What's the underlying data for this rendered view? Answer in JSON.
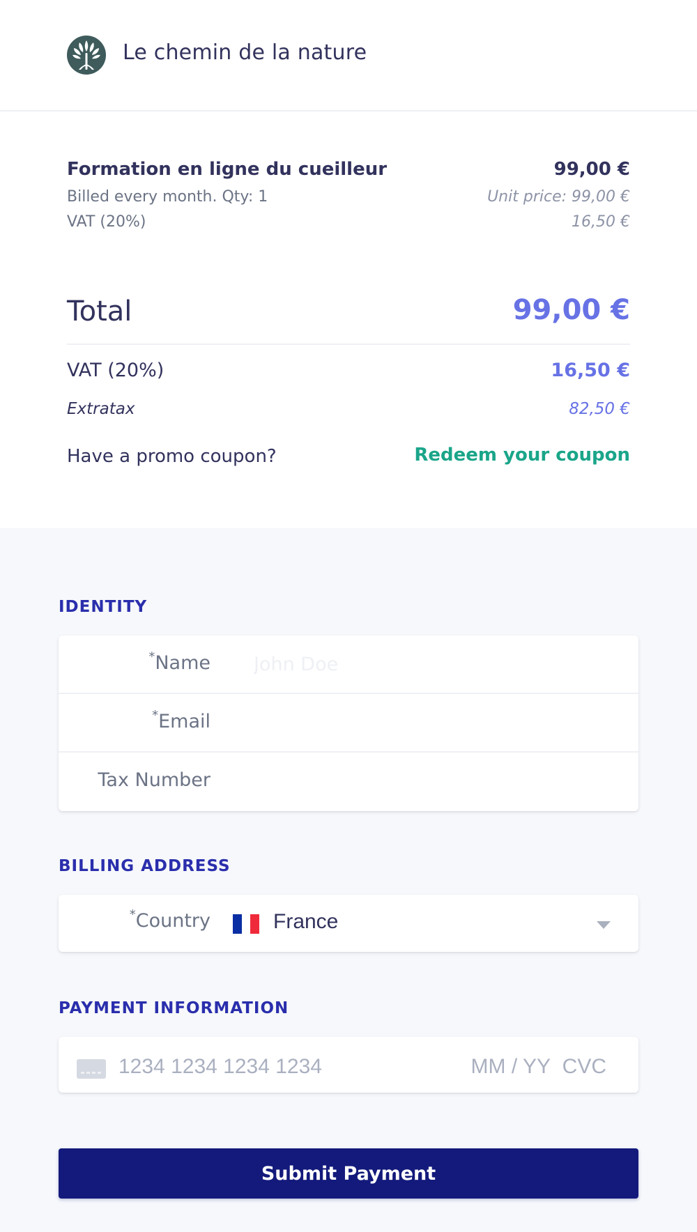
{
  "brand": {
    "name": "Le chemin de la nature",
    "logo_icon": "tree-of-life-icon",
    "logo_color": "#3f5b5c"
  },
  "item": {
    "name": "Formation en ligne du cueilleur",
    "price": "99,00 €",
    "billing": "Billed every month. Qty: 1",
    "unit_price": "Unit price: 99,00 €",
    "vat_label": "VAT (20%)",
    "vat_amount": "16,50 €"
  },
  "totals": {
    "total_label": "Total",
    "total_value": "99,00 €",
    "vat_label": "VAT (20%)",
    "vat_value": "16,50 €",
    "extratax_label": "Extratax",
    "extratax_value": "82,50 €",
    "promo_label": "Have a promo coupon?",
    "promo_link": "Redeem your coupon"
  },
  "identity": {
    "title": "IDENTITY",
    "name_required": "*",
    "name_label": "Name",
    "name_placeholder": "John Doe",
    "email_required": "*",
    "email_label": "Email",
    "tax_label": "Tax Number"
  },
  "billing": {
    "title": "BILLING ADDRESS",
    "country_required": "*",
    "country_label": "Country",
    "country_value": "France",
    "flag_colors": [
      "#0a2ea3",
      "#ffffff",
      "#ef2b3b"
    ]
  },
  "payment": {
    "title": "PAYMENT INFORMATION",
    "card_icon": "credit-card-icon",
    "card_placeholder": "1234 1234 1234 1234",
    "expiry_placeholder": "MM / YY",
    "cvc_placeholder": "CVC"
  },
  "submit_label": "Submit Payment",
  "colors": {
    "accent": "#6772e5",
    "link": "#1aa589",
    "section_title": "#2a2eac",
    "button": "#131a7b"
  }
}
